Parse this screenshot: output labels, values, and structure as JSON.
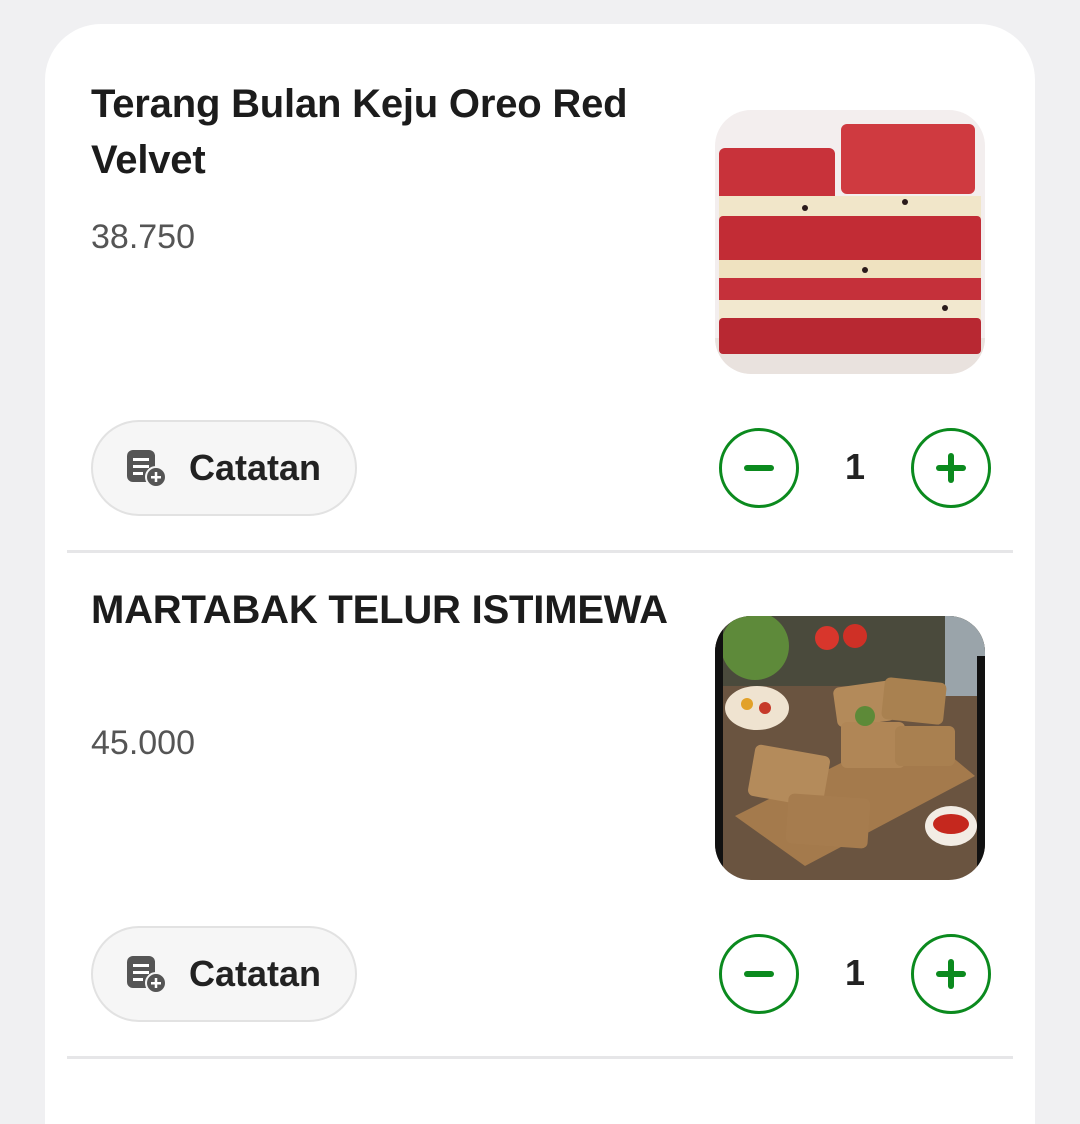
{
  "items": [
    {
      "title": "Terang Bulan Keju Oreo Red Velvet",
      "price": "38.750",
      "image": "red-velvet-pancake-photo",
      "note_label": "Catatan",
      "quantity": "1"
    },
    {
      "title": "MARTABAK TELUR ISTIMEWA",
      "price": "45.000",
      "image": "martabak-telur-photo",
      "note_label": "Catatan",
      "quantity": "1"
    }
  ],
  "colors": {
    "accent": "#0b8a1e",
    "background": "#f0f0f2",
    "card": "#ffffff"
  },
  "icons": {
    "note": "note-add-icon",
    "minus": "minus-icon",
    "plus": "plus-icon"
  }
}
